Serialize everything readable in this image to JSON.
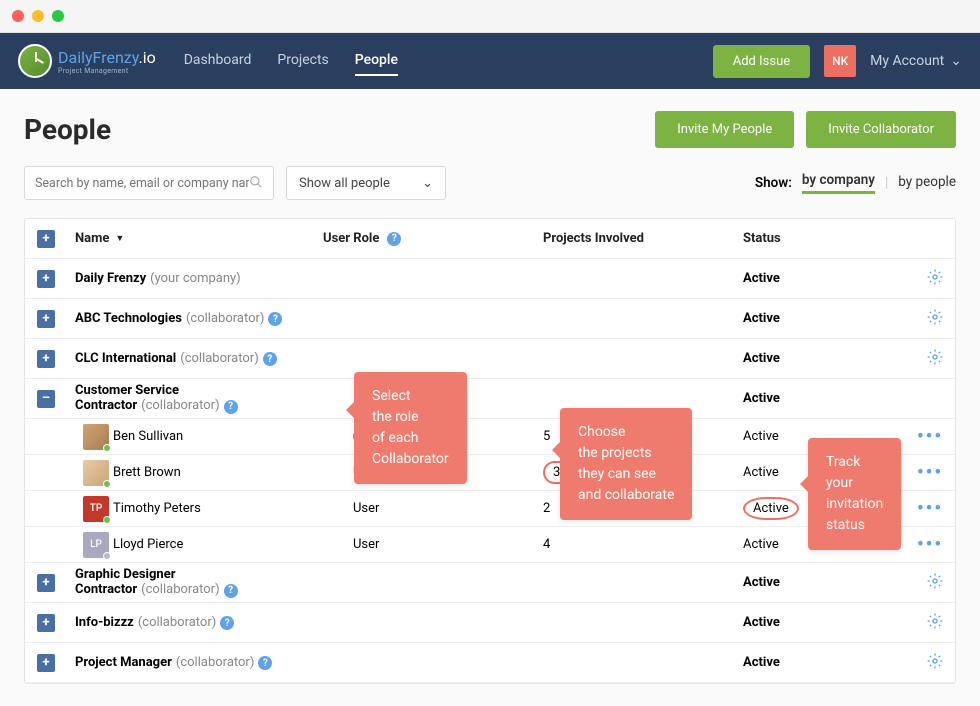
{
  "brand": {
    "name": "DailyFrenzy",
    "suffix": ".io",
    "tagline": "Project Management"
  },
  "nav": {
    "dashboard": "Dashboard",
    "projects": "Projects",
    "people": "People",
    "addIssue": "Add Issue",
    "avatar": "NK",
    "myAccount": "My Account"
  },
  "page": {
    "title": "People",
    "inviteMy": "Invite My People",
    "inviteCollab": "Invite Collaborator"
  },
  "filters": {
    "searchPlaceholder": "Search by name, email or company name",
    "showAll": "Show all people",
    "showLabel": "Show:",
    "byCompany": "by company",
    "byPeople": "by people"
  },
  "columns": {
    "name": "Name",
    "role": "User Role",
    "projects": "Projects Involved",
    "status": "Status"
  },
  "groups": [
    {
      "name": "Daily Frenzy",
      "meta": "(your company)",
      "status": "Active",
      "help": false
    },
    {
      "name": "ABC Technologies",
      "meta": "(collaborator)",
      "status": "Active",
      "help": true
    },
    {
      "name": "CLC International",
      "meta": "(collaborator)",
      "status": "Active",
      "help": true
    }
  ],
  "expanded": {
    "name": "Customer Service Contractor",
    "meta": "(collaborator)",
    "status": "Active",
    "help": true
  },
  "people": [
    {
      "name": "Ben Sullivan",
      "role": "User",
      "projects": "5",
      "status": "Active",
      "initials": "",
      "avatarClass": "img1",
      "presence": "online",
      "circledRole": true,
      "circledProj": false,
      "circledStatus": false
    },
    {
      "name": "Brett Brown",
      "role": "User",
      "projects": "3",
      "status": "Active",
      "initials": "",
      "avatarClass": "img2",
      "presence": "online",
      "circledRole": false,
      "circledProj": true,
      "circledStatus": false
    },
    {
      "name": "Timothy Peters",
      "role": "User",
      "projects": "2",
      "status": "Active",
      "initials": "TP",
      "avatarClass": "tp",
      "presence": "online",
      "circledRole": false,
      "circledProj": false,
      "circledStatus": true
    },
    {
      "name": "Lloyd Pierce",
      "role": "User",
      "projects": "4",
      "status": "Active",
      "initials": "LP",
      "avatarClass": "lp",
      "presence": "offline",
      "circledRole": false,
      "circledProj": false,
      "circledStatus": false
    }
  ],
  "groupsAfter": [
    {
      "name": "Graphic Designer Contractor",
      "meta": "(collaborator)",
      "status": "Active",
      "help": true
    },
    {
      "name": "Info-bizzz",
      "meta": "(collaborator)",
      "status": "Active",
      "help": true
    },
    {
      "name": "Project Manager",
      "meta": "(collaborator)",
      "status": "Active",
      "help": true
    }
  ],
  "callouts": {
    "c1": "Select\nthe role\nof each\nCollaborator",
    "c2": "Choose\nthe projects\nthey can see\nand collaborate",
    "c3": "Track\nyour\ninvitation\nstatus"
  }
}
